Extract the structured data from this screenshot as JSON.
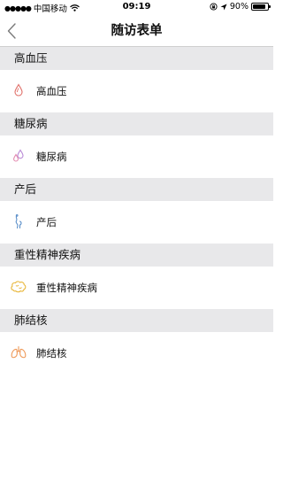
{
  "status_bar": {
    "signal_dots": "●●●●●",
    "carrier": "中国移动",
    "time": "09:19",
    "battery_percent": "90%",
    "battery_level": 0.9
  },
  "nav": {
    "title": "随访表单"
  },
  "sections": [
    {
      "header": "高血压",
      "item": "高血压",
      "icon": "blood-drop-icon",
      "icon_color": "#e0706a"
    },
    {
      "header": "糖尿病",
      "item": "糖尿病",
      "icon": "drops-icon",
      "icon_color": "#b98ad6"
    },
    {
      "header": "产后",
      "item": "产后",
      "icon": "postpartum-icon",
      "icon_color": "#5b8fc9"
    },
    {
      "header": "重性精神疾病",
      "item": "重性精神疾病",
      "icon": "brain-icon",
      "icon_color": "#e9b83e"
    },
    {
      "header": "肺结核",
      "item": "肺结核",
      "icon": "lungs-icon",
      "icon_color": "#ef9a5a"
    }
  ]
}
